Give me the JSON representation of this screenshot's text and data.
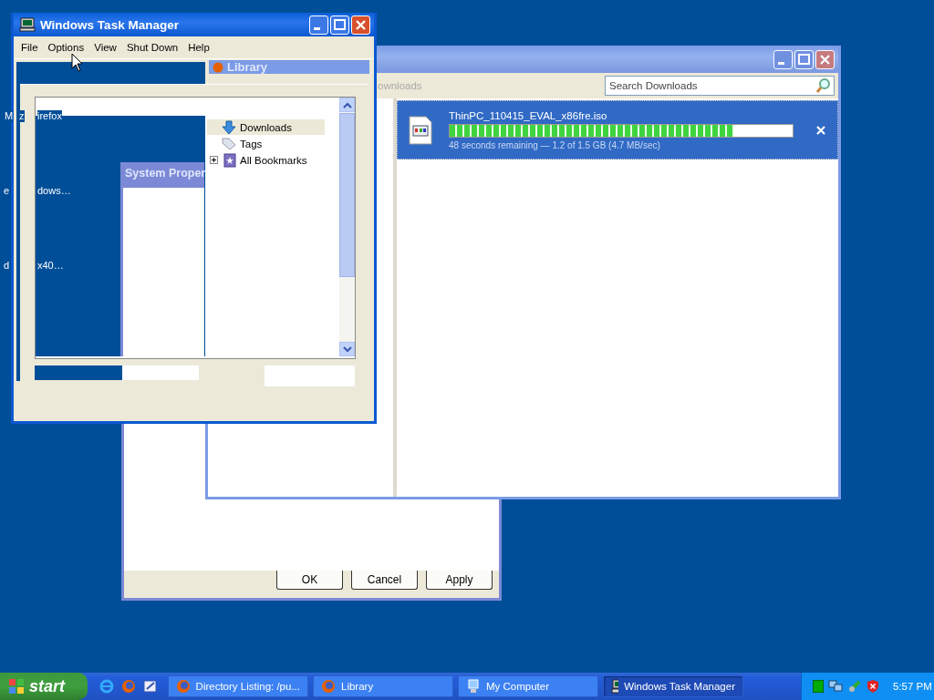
{
  "desktop": {
    "label_fragments": [
      "M",
      "z",
      "irefox",
      "e",
      "dows…",
      "d",
      "x40…"
    ]
  },
  "system_properties": {
    "title": "System Proper",
    "buttons": [
      "OK",
      "Cancel",
      "Apply"
    ]
  },
  "library": {
    "toolbar_fragment": "ownloads",
    "search": {
      "placeholder": "Search Downloads"
    },
    "downloads": [
      {
        "name": "ThinPC_110415_EVAL_x86fre.iso",
        "level": 0.83,
        "status": "48 seconds remaining — 1.2 of 1.5 GB (4.7 MB/sec)",
        "selected": true
      }
    ]
  },
  "task_manager": {
    "title": "Windows Task Manager",
    "menu": [
      "File",
      "Options",
      "View",
      "Shut Down",
      "Help"
    ],
    "library_fragment_title": "Library",
    "sidebar_items": [
      {
        "label": "Downloads",
        "selected": true,
        "kind": "downloads"
      },
      {
        "label": "Tags",
        "selected": false,
        "kind": "tags"
      },
      {
        "label": "All Bookmarks",
        "selected": false,
        "kind": "bookmarks"
      }
    ]
  },
  "taskbar": {
    "start": "start",
    "tasks": [
      {
        "label": "Directory Listing: /pu...",
        "selected": false,
        "kind": "browser"
      },
      {
        "label": "Library",
        "selected": false,
        "kind": "browser"
      },
      {
        "label": "My Computer",
        "selected": false,
        "kind": "computer"
      },
      {
        "label": "Windows Task Manager",
        "selected": true,
        "kind": "taskmgr"
      }
    ],
    "clock": "5:57 PM"
  }
}
